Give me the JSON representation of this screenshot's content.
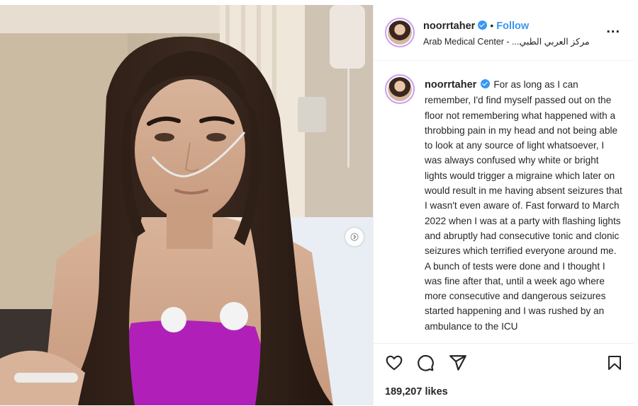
{
  "post": {
    "username": "noorrtaher",
    "follow_label": "Follow",
    "separator": "•",
    "location": "Arab Medical Center - ...مركز العربي الطبي",
    "more_label": "...",
    "caption": "For as long as I can remember, I'd find myself passed out on the floor not remembering what happened with a throbbing pain in my head and not being able to look at any source of light whatsoever, I was always confused why white or bright lights would trigger a migraine which later on would result in me having absent seizures that I wasn't even aware of. Fast forward to March 2022 when I was at a party with flashing lights and abruptly had consecutive tonic and clonic seizures which terrified everyone around me. A bunch of tests were done and I thought I was fine after that, until a week ago where more consecutive and dangerous seizures started happening and I was rushed by an ambulance to the ICU",
    "likes": "189,207 likes"
  },
  "icons": {
    "verified": "verified-badge-icon",
    "like": "heart-icon",
    "comment": "comment-icon",
    "share": "share-icon",
    "save": "bookmark-icon",
    "next": "chevron-right-icon"
  },
  "colors": {
    "accent": "#3897f0",
    "text": "#262626",
    "avatar_ring": "#c8a0f0",
    "top_magenta": "#b020b8"
  }
}
